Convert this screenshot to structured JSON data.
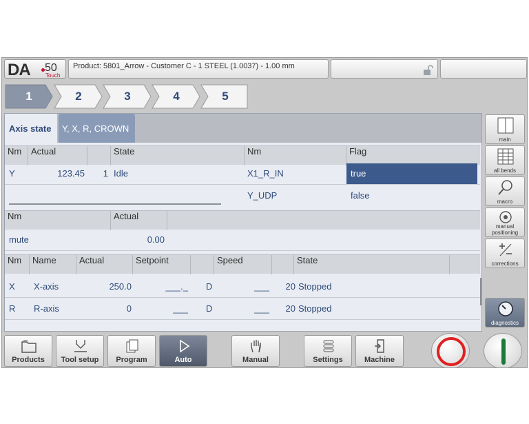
{
  "header": {
    "logo": {
      "brand": "DA",
      "model": "50",
      "sub": "Touch"
    },
    "product": "Product: 5801_Arrow - Customer C - 1 STEEL (1.0037) - 1.00 mm"
  },
  "steps": [
    "1",
    "2",
    "3",
    "4",
    "5"
  ],
  "tabs": {
    "axis_state": "Axis state",
    "yxr": "Y, X, R, CROWN"
  },
  "table1": {
    "headers": {
      "nm": "Nm",
      "actual": "Actual",
      "state": "State",
      "nm2": "Nm",
      "flag": "Flag"
    },
    "row": {
      "nm": "Y",
      "actual": "123.45",
      "num": "1",
      "state": "Idle"
    },
    "flags": [
      {
        "nm": "X1_R_IN",
        "flag": "true"
      },
      {
        "nm": "Y_UDP",
        "flag": "false"
      }
    ]
  },
  "table2": {
    "headers": {
      "nm": "Nm",
      "actual": "Actual"
    },
    "row": {
      "nm": "mute",
      "actual": "0.00"
    }
  },
  "table3": {
    "headers": {
      "nm": "Nm",
      "name": "Name",
      "actual": "Actual",
      "setpoint": "Setpoint",
      "speed": "Speed",
      "state": "State"
    },
    "rows": [
      {
        "nm": "X",
        "name": "X-axis",
        "actual": "250.0",
        "setpoint": "___._",
        "d": "D",
        "speed_blank": "___",
        "speed": "20",
        "state": "Stopped"
      },
      {
        "nm": "R",
        "name": "R-axis",
        "actual": "0",
        "setpoint": "___",
        "d": "D",
        "speed_blank": "___",
        "speed": "20",
        "state": "Stopped"
      }
    ]
  },
  "side_buttons": {
    "main": "main",
    "all_bends": "all bends",
    "macro": "macro",
    "manual_1": "manual",
    "manual_2": "positioning",
    "corrections": "corrections",
    "diagnostics": "diagnostics"
  },
  "bottom_nav": {
    "products": "Products",
    "tool_setup": "Tool setup",
    "program": "Program",
    "auto": "Auto",
    "manual": "Manual",
    "settings": "Settings",
    "machine": "Machine"
  },
  "colors": {
    "accent": "#3c5a8c",
    "text": "#2f4a7a",
    "stop": "#e02020",
    "start": "#1a7a3a"
  }
}
